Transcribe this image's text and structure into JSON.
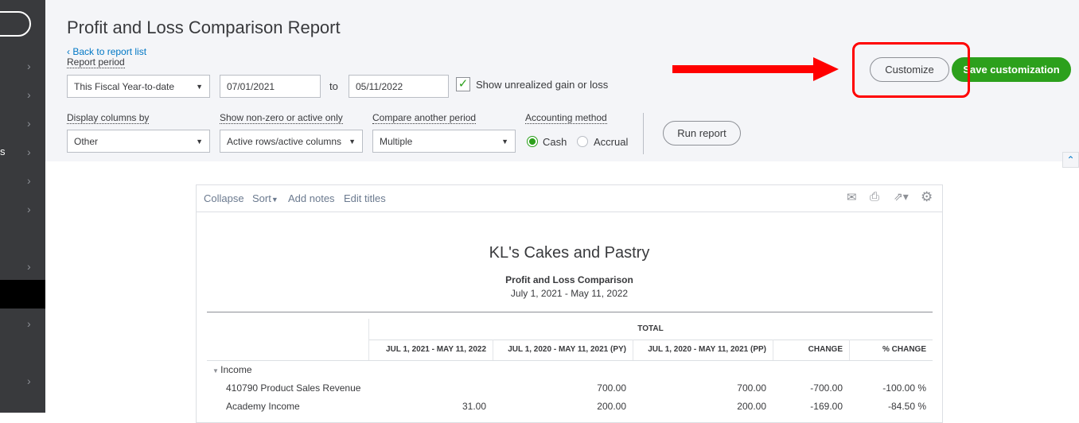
{
  "sidebar": {
    "partial_label": "s"
  },
  "header": {
    "title": "Profit and Loss Comparison Report",
    "back_link": "Back to report list",
    "report_period_label": "Report period",
    "report_period_value": "This Fiscal Year-to-date",
    "from_date": "07/01/2021",
    "to_label": "to",
    "to_date": "05/11/2022",
    "unrealized_label": "Show unrealized gain or loss",
    "unrealized_checked": true,
    "display_columns_label": "Display columns by",
    "display_columns_value": "Other",
    "nonzero_label": "Show non-zero or active only",
    "nonzero_value": "Active rows/active columns",
    "compare_label": "Compare another period",
    "compare_value": "Multiple",
    "accounting_label": "Accounting method",
    "cash_label": "Cash",
    "accrual_label": "Accrual",
    "accounting_selected": "Cash",
    "run_report": "Run report",
    "customize": "Customize",
    "save_customization": "Save customization"
  },
  "colors": {
    "accent_green": "#2ca01c",
    "annotation_red": "#ff0000"
  },
  "toolbar": {
    "collapse": "Collapse",
    "sort": "Sort",
    "add_notes": "Add notes",
    "edit_titles": "Edit titles"
  },
  "report": {
    "company": "KL's Cakes and Pastry",
    "title": "Profit and Loss Comparison",
    "dates": "July 1, 2021 - May 11, 2022",
    "group_header": "TOTAL",
    "columns": [
      "JUL 1, 2021 - MAY 11, 2022",
      "JUL 1, 2020 - MAY 11, 2021 (PY)",
      "JUL 1, 2020 - MAY 11, 2021 (PP)",
      "CHANGE",
      "% CHANGE"
    ],
    "section": "Income",
    "rows": [
      {
        "name": "410790 Product Sales Revenue",
        "values": [
          "",
          "700.00",
          "700.00",
          "-700.00",
          "-100.00 %"
        ]
      },
      {
        "name": "Academy Income",
        "values": [
          "31.00",
          "200.00",
          "200.00",
          "-169.00",
          "-84.50 %"
        ]
      }
    ]
  }
}
